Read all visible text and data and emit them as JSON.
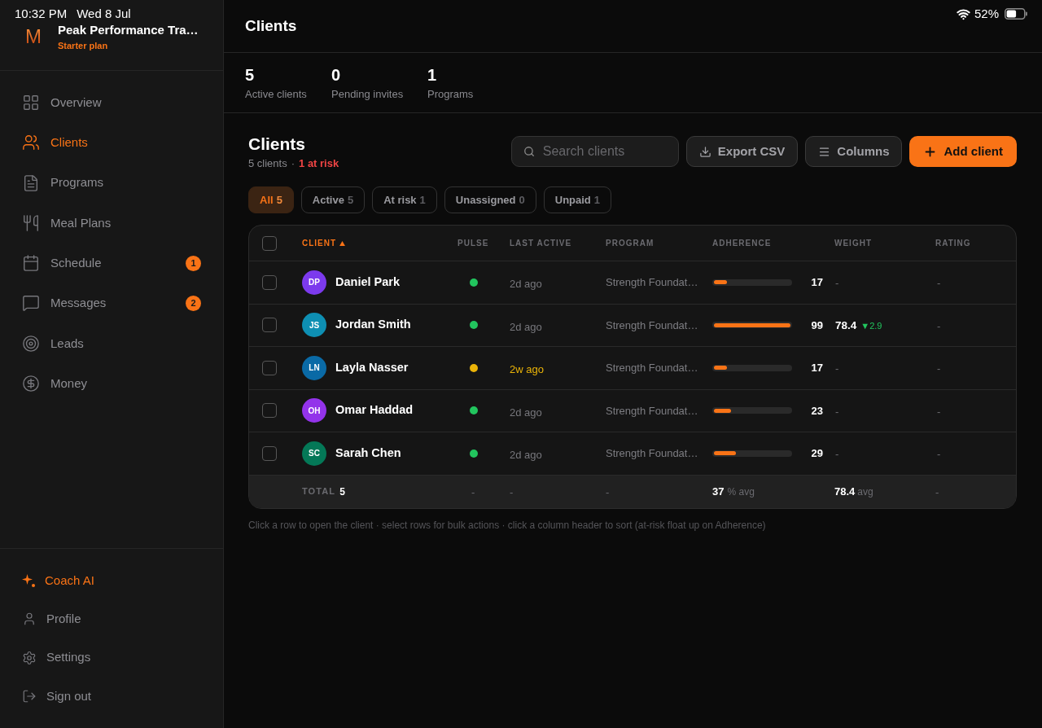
{
  "status_bar": {
    "time": "10:32 PM",
    "date": "Wed 8 Jul",
    "battery": "52%"
  },
  "sidebar": {
    "logo": "M",
    "workspace": "Peak Performance Tra…",
    "plan": "Starter plan",
    "nav": [
      {
        "label": "Overview",
        "selected": false
      },
      {
        "label": "Clients",
        "selected": true
      },
      {
        "label": "Programs",
        "selected": false
      },
      {
        "label": "Meal Plans",
        "selected": false
      },
      {
        "label": "Schedule",
        "selected": false,
        "badge": "1"
      },
      {
        "label": "Messages",
        "selected": false,
        "badge": "2"
      },
      {
        "label": "Leads",
        "selected": false
      },
      {
        "label": "Money",
        "selected": false
      }
    ],
    "footer": [
      {
        "label": "Coach AI",
        "highlighted": true
      },
      {
        "label": "Profile",
        "highlighted": false
      },
      {
        "label": "Settings",
        "highlighted": false
      },
      {
        "label": "Sign out",
        "highlighted": false
      }
    ]
  },
  "header": {
    "title": "Clients"
  },
  "stats": [
    {
      "value": "5",
      "label": "Active clients"
    },
    {
      "value": "0",
      "label": "Pending invites"
    },
    {
      "value": "1",
      "label": "Programs"
    }
  ],
  "clients": {
    "title": "Clients",
    "summary": "5 clients",
    "separator": "·",
    "risk": "1 at risk",
    "search": {
      "placeholder": "Search clients"
    },
    "buttons": [
      {
        "label": "Export CSV",
        "kind": "secondary"
      },
      {
        "label": "Columns",
        "kind": "secondary"
      },
      {
        "label": "Add client",
        "kind": "primary"
      }
    ],
    "filters": [
      {
        "label": "All",
        "count": "5",
        "selected": true
      },
      {
        "label": "Active",
        "count": "5",
        "selected": false
      },
      {
        "label": "At risk",
        "count": "1",
        "selected": false
      },
      {
        "label": "Unassigned",
        "count": "0",
        "selected": false
      },
      {
        "label": "Unpaid",
        "count": "1",
        "selected": false
      }
    ],
    "table": {
      "header_checked": false,
      "columns": [
        {
          "label": "CLIENT",
          "sorted": true
        },
        {
          "label": "PULSE",
          "sorted": false
        },
        {
          "label": "LAST ACTIVE",
          "sorted": false
        },
        {
          "label": "PROGRAM",
          "sorted": false
        },
        {
          "label": "ADHERENCE",
          "sorted": false
        },
        {
          "label": "WEIGHT",
          "sorted": false
        },
        {
          "label": "RATING",
          "sorted": false
        }
      ],
      "rows": [
        {
          "checked": false,
          "avatar": {
            "initials": "DP",
            "color": "#7c3aed"
          },
          "name": "Daniel Park",
          "pulse": {
            "color": "#22c55e"
          },
          "last_active": "2d ago",
          "at_risk": false,
          "program": "Strength Foundat…",
          "adherence": {
            "level": 0.17,
            "value": "17"
          },
          "weight": {
            "kind": "empty",
            "value": "-"
          },
          "rating": "-"
        },
        {
          "checked": false,
          "avatar": {
            "initials": "JS",
            "color": "#0e8fb3"
          },
          "name": "Jordan Smith",
          "pulse": {
            "color": "#22c55e"
          },
          "last_active": "2d ago",
          "at_risk": false,
          "program": "Strength Foundat…",
          "adherence": {
            "level": 0.99,
            "value": "99"
          },
          "weight": {
            "kind": "value",
            "value": "78.4",
            "change": "▼2.9"
          },
          "rating": "-"
        },
        {
          "checked": false,
          "avatar": {
            "initials": "LN",
            "color": "#0a6aa6"
          },
          "name": "Layla Nasser",
          "pulse": {
            "color": "#eab308"
          },
          "last_active": "2w ago",
          "at_risk": true,
          "program": "Strength Foundat…",
          "adherence": {
            "level": 0.17,
            "value": "17"
          },
          "weight": {
            "kind": "empty",
            "value": "-"
          },
          "rating": "-"
        },
        {
          "checked": false,
          "avatar": {
            "initials": "OH",
            "color": "#9333ea"
          },
          "name": "Omar Haddad",
          "pulse": {
            "color": "#22c55e"
          },
          "last_active": "2d ago",
          "at_risk": false,
          "program": "Strength Foundat…",
          "adherence": {
            "level": 0.23,
            "value": "23"
          },
          "weight": {
            "kind": "empty",
            "value": "-"
          },
          "rating": "-"
        },
        {
          "checked": false,
          "avatar": {
            "initials": "SC",
            "color": "#047857"
          },
          "name": "Sarah Chen",
          "pulse": {
            "color": "#22c55e"
          },
          "last_active": "2d ago",
          "at_risk": false,
          "program": "Strength Foundat…",
          "adherence": {
            "level": 0.29,
            "value": "29"
          },
          "weight": {
            "kind": "empty",
            "value": "-"
          },
          "rating": "-"
        }
      ],
      "total": {
        "label": "TOTAL",
        "count": "5",
        "pulse": "-",
        "last_active": "-",
        "program": "-",
        "adherence": "37",
        "adherence_note": "% avg",
        "weight": "78.4",
        "weight_note": "avg",
        "rating": "-"
      }
    },
    "hint": "Click a row to open the client · select rows for bulk actions · click a column header to sort (at-risk float up on Adherence)"
  }
}
